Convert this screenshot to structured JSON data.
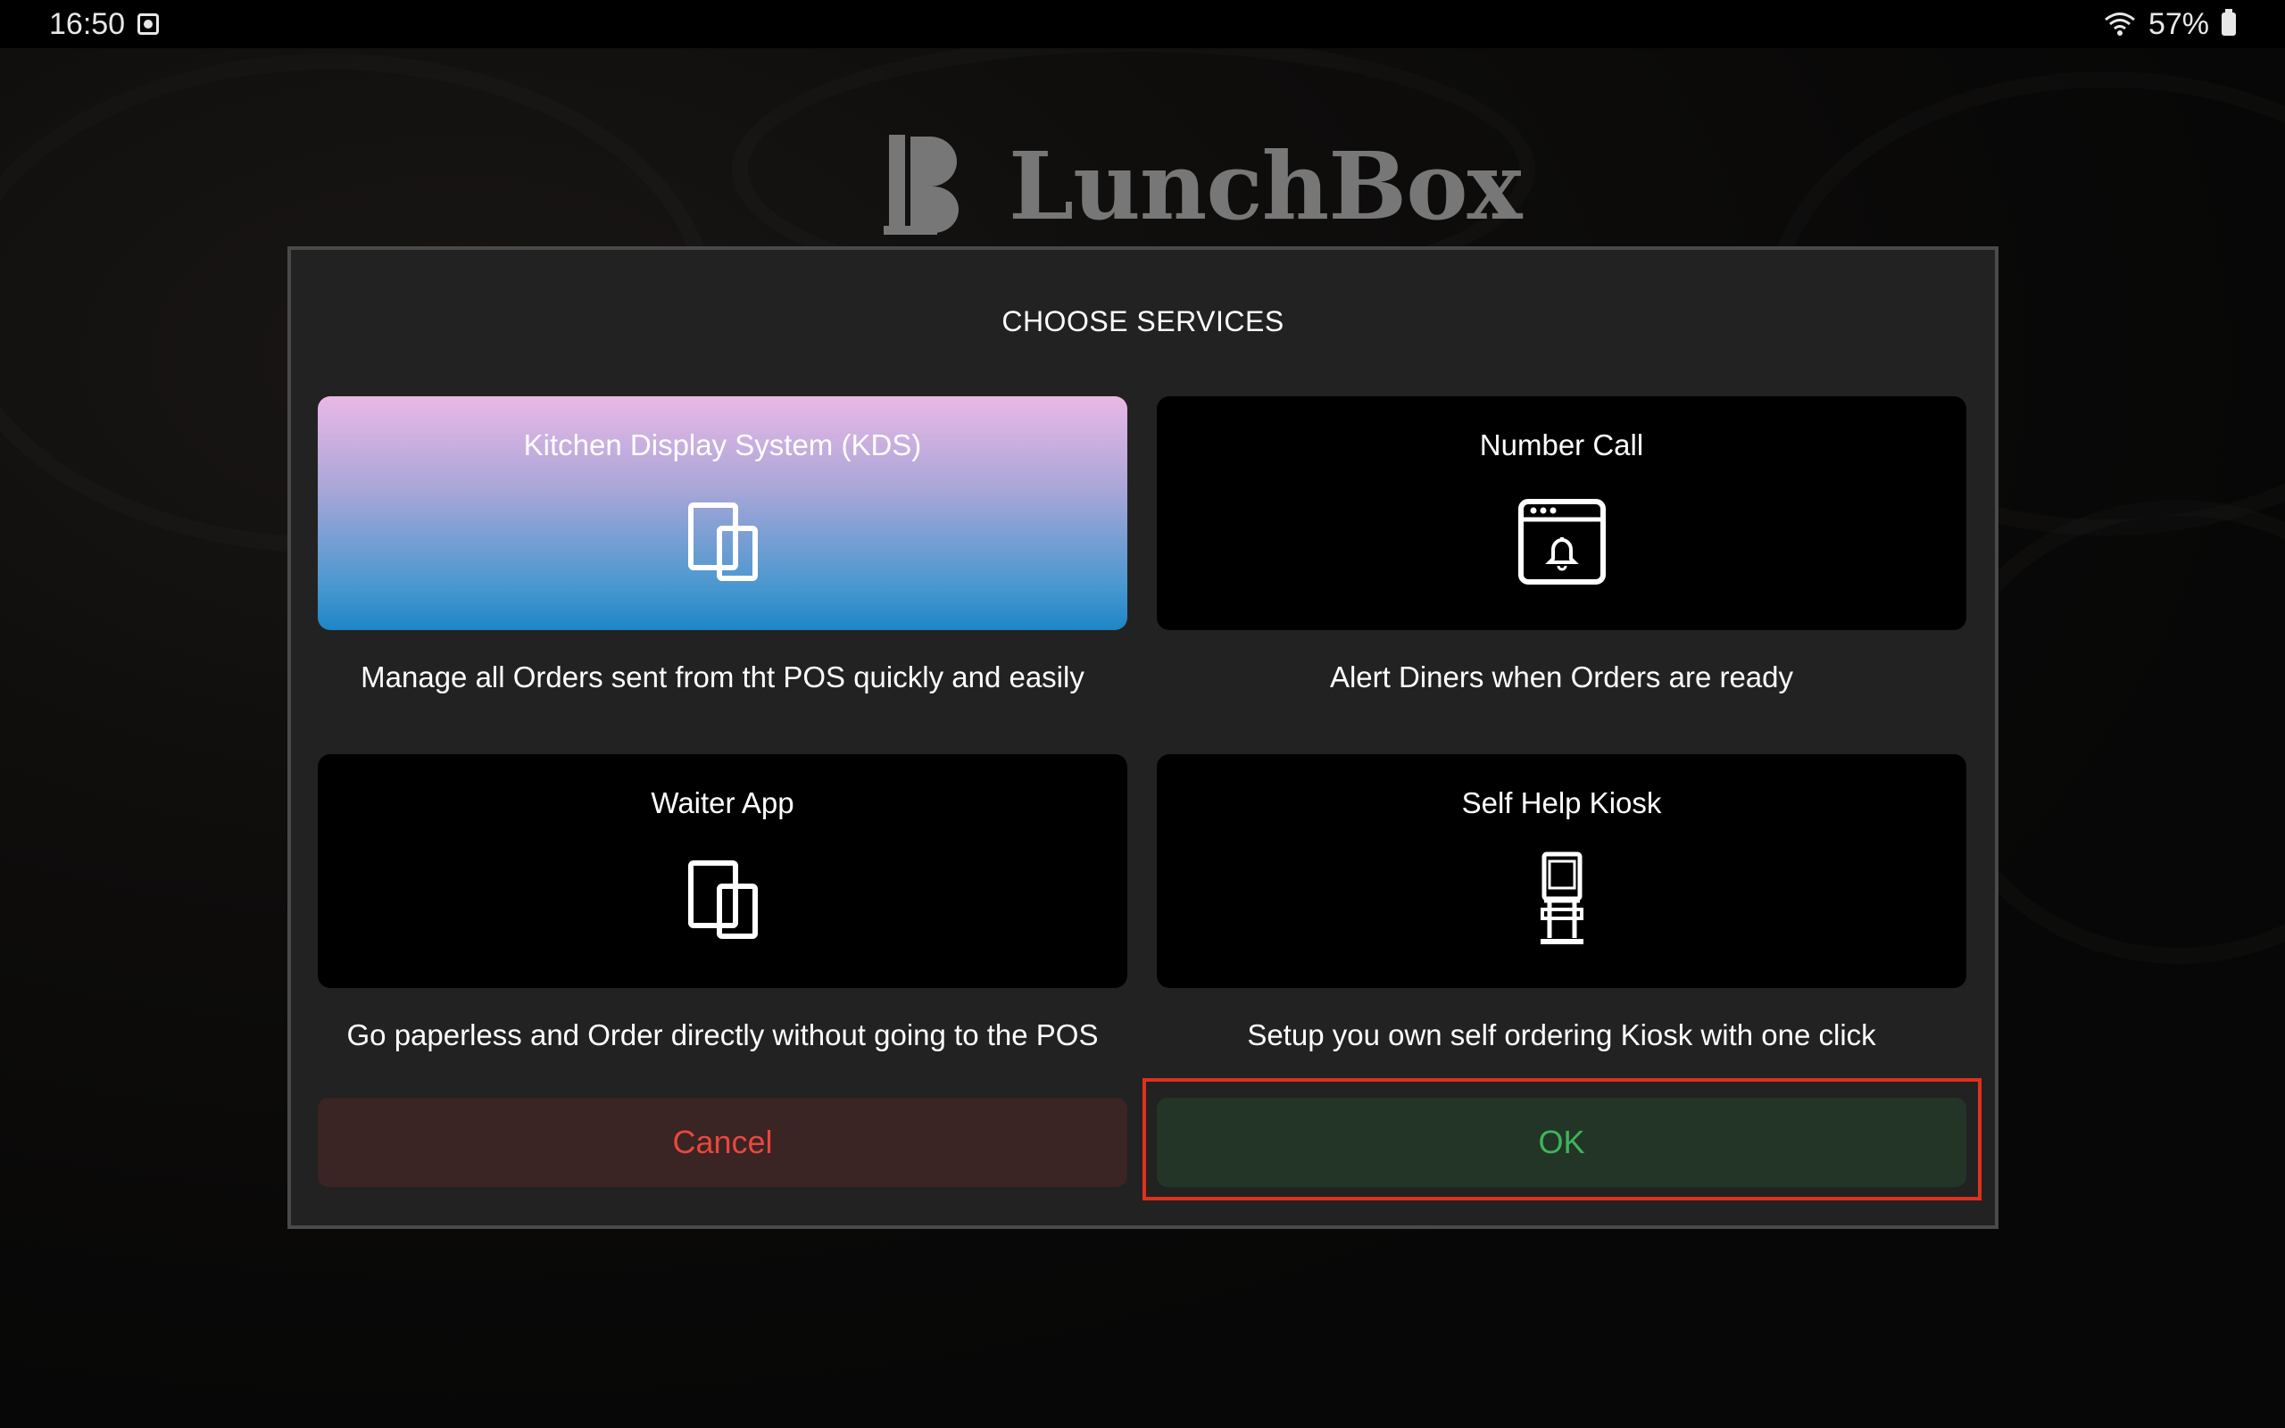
{
  "status_bar": {
    "time": "16:50",
    "battery": "57%"
  },
  "logo": {
    "name": "LunchBox"
  },
  "dialog": {
    "title": "CHOOSE SERVICES",
    "services": [
      {
        "title": "Kitchen Display System (KDS)",
        "description": "Manage all Orders sent from tht POS quickly and easily",
        "icon": "devices-icon",
        "selected": true
      },
      {
        "title": "Number Call",
        "description": "Alert Diners when Orders are ready",
        "icon": "window-bell-icon",
        "selected": false
      },
      {
        "title": "Waiter App",
        "description": "Go paperless and Order directly without going to the POS",
        "icon": "devices-icon",
        "selected": false
      },
      {
        "title": "Self Help Kiosk",
        "description": "Setup you own self ordering Kiosk with one click",
        "icon": "kiosk-icon",
        "selected": false
      }
    ],
    "cancel_label": "Cancel",
    "ok_label": "OK"
  },
  "colors": {
    "cancel_text": "#e8473e",
    "ok_text": "#3fb45c",
    "highlight": "#e0301e"
  }
}
